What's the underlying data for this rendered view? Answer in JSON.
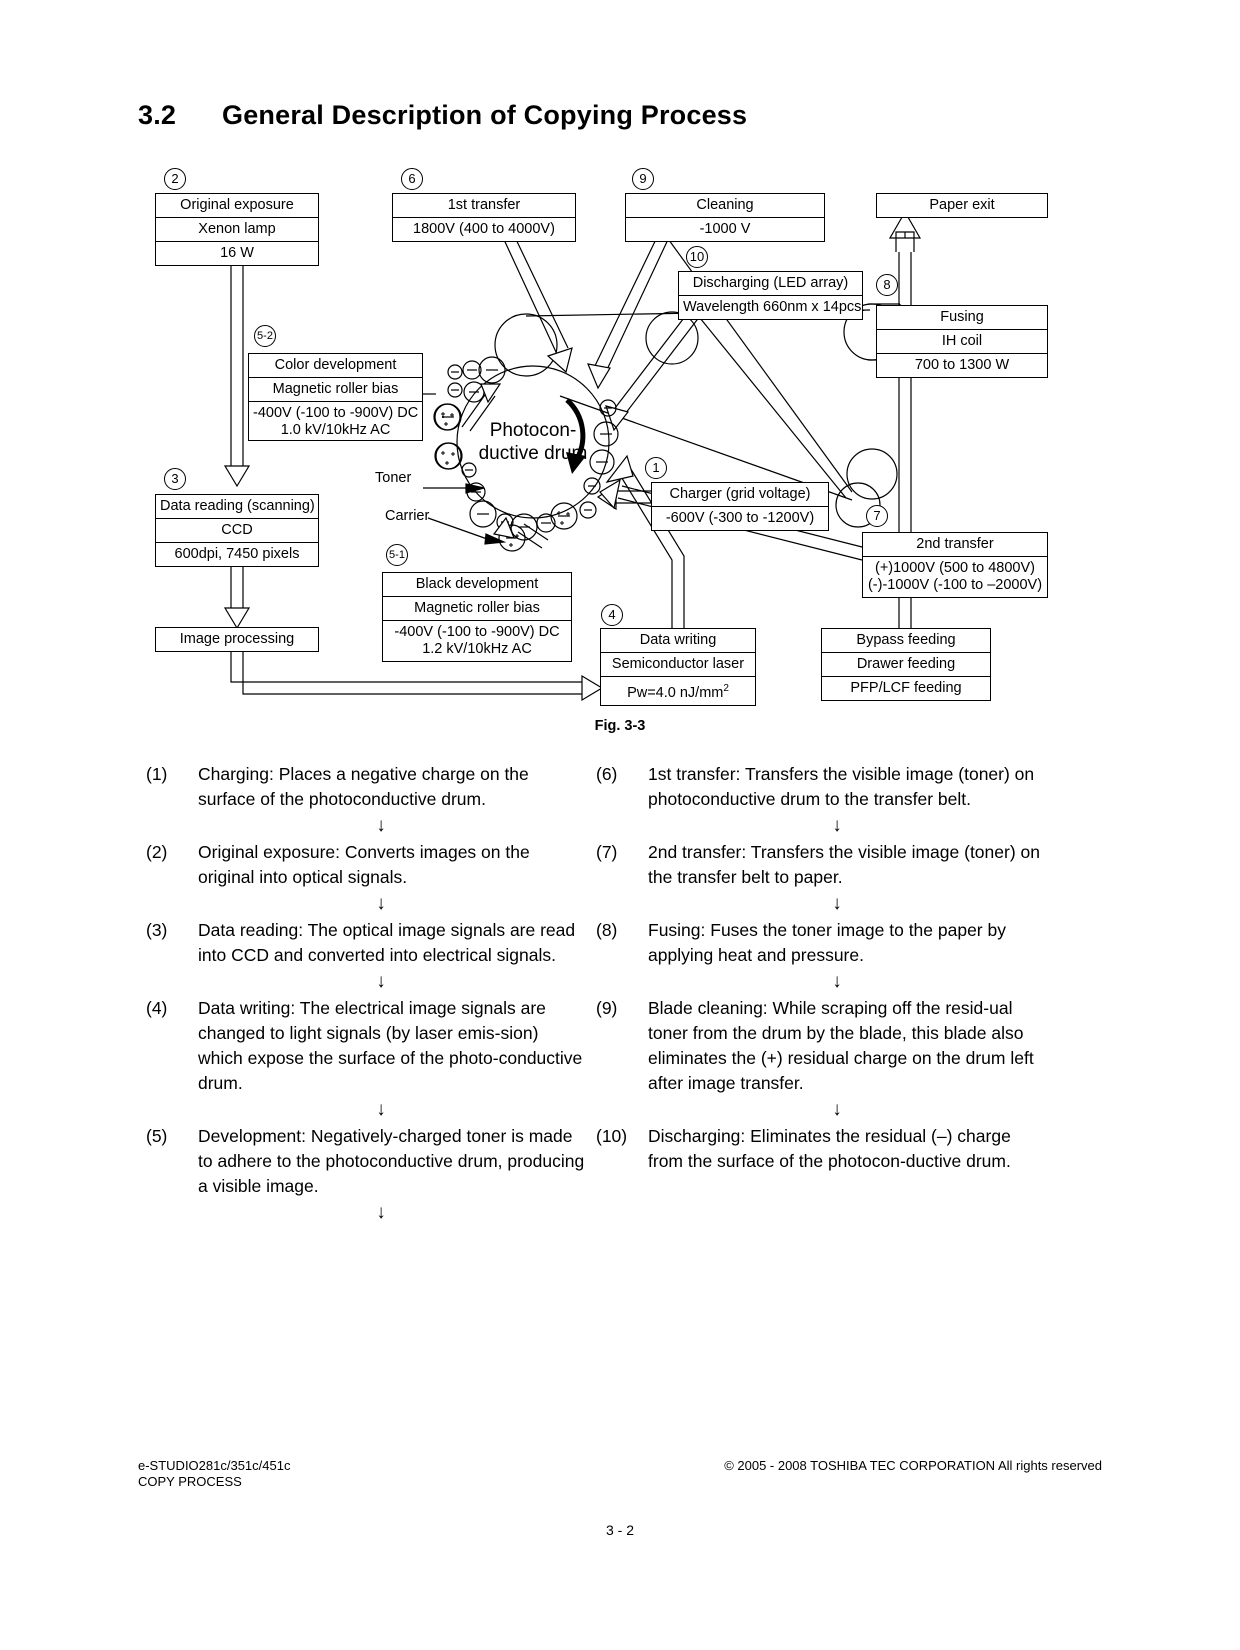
{
  "title": {
    "number": "3.2",
    "text": "General Description of Copying Process"
  },
  "figure": {
    "caption": "Fig. 3-3"
  },
  "diagram": {
    "drum_label_line1": "Photocon-",
    "drum_label_line2": "ductive drum",
    "toner_label": "Toner",
    "carrier_label": "Carrier",
    "steps": {
      "n1": "1",
      "n2": "2",
      "n3": "3",
      "n4": "4",
      "n5_1": "5-1",
      "n5_2": "5-2",
      "n6": "6",
      "n7": "7",
      "n8": "8",
      "n9": "9",
      "n10": "10"
    },
    "boxes": {
      "original_exposure": {
        "rows": [
          "Original  exposure",
          "Xenon lamp",
          "16 W"
        ]
      },
      "first_transfer": {
        "rows": [
          "1st transfer",
          "1800V (400 to 4000V)"
        ]
      },
      "cleaning": {
        "rows": [
          "Cleaning",
          "-1000 V"
        ]
      },
      "paper_exit": {
        "rows": [
          "Paper exit"
        ]
      },
      "discharging": {
        "rows": [
          "Discharging (LED array)",
          "Wavelength 660nm x 14pcs."
        ]
      },
      "fusing": {
        "rows": [
          "Fusing",
          "IH coil",
          "700 to 1300 W"
        ]
      },
      "color_development": {
        "rows": [
          "Color development",
          "Magnetic roller bias"
        ],
        "dc": "-400V (-100 to -900V) DC",
        "ac": "1.0 kV/10kHz AC"
      },
      "data_reading": {
        "rows": [
          "Data reading (scanning)",
          "CCD",
          "600dpi, 7450 pixels"
        ]
      },
      "image_processing": {
        "rows": [
          "Image processing"
        ]
      },
      "black_development": {
        "rows": [
          "Black development",
          "Magnetic roller bias"
        ],
        "dc": "-400V (-100 to -900V) DC",
        "ac": "1.2 kV/10kHz AC"
      },
      "charger": {
        "rows": [
          "Charger (grid voltage)",
          "-600V (-300 to -1200V)"
        ]
      },
      "second_transfer": {
        "title": "2nd transfer",
        "pos": "(+)1000V (500 to 4800V)",
        "neg": "(-)-1000V (-100 to –2000V)"
      },
      "data_writing": {
        "title": "Data writing",
        "laser": "Semiconductor laser",
        "power_pre": "Pw=4.0 nJ/mm",
        "power_sup": "2"
      },
      "feeding": {
        "rows": [
          "Bypass feeding",
          "Drawer feeding",
          "PFP/LCF feeding"
        ]
      }
    }
  },
  "steps_left": [
    {
      "index": "(1)",
      "text": "Charging: Places a negative charge on the surface of the photoconductive drum."
    },
    {
      "index": "(2)",
      "text": "Original exposure: Converts images on the original into optical signals."
    },
    {
      "index": "(3)",
      "text": "Data reading: The optical image signals are read into CCD and converted into electrical signals."
    },
    {
      "index": "(4)",
      "text": "Data writing: The electrical image signals are changed to light signals (by laser emis-sion) which expose the surface of the photo-conductive drum."
    },
    {
      "index": "(5)",
      "text": "Development: Negatively-charged toner is made to adhere to the photoconductive drum, producing a visible image."
    }
  ],
  "steps_right": [
    {
      "index": "(6)",
      "text": "1st transfer: Transfers the visible image (toner) on photoconductive drum to the transfer belt."
    },
    {
      "index": "(7)",
      "text": "2nd transfer: Transfers the visible image (toner) on the transfer belt to paper."
    },
    {
      "index": "(8)",
      "text": "Fusing: Fuses the toner image to the paper by applying heat and pressure."
    },
    {
      "index": "(9)",
      "text": "Blade cleaning: While scraping off the resid-ual toner from the drum by the blade, this blade also eliminates the (+) residual charge on the drum left after image transfer."
    },
    {
      "index": "(10)",
      "text": "Discharging: Eliminates the residual (–) charge from the surface of the photocon-ductive drum."
    }
  ],
  "arrow_glyph": "↓",
  "footer": {
    "model": "e-STUDIO281c/351c/451c",
    "section": "COPY PROCESS",
    "copyright": "© 2005 - 2008 TOSHIBA TEC CORPORATION All rights reserved",
    "page": "3 - 2"
  }
}
